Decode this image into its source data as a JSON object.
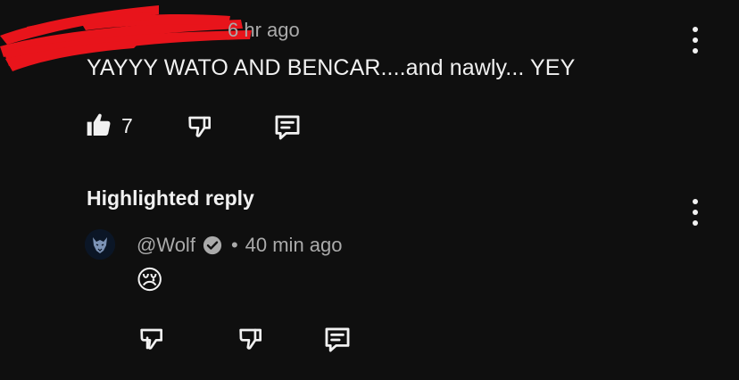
{
  "comment": {
    "timestamp": "6 hr ago",
    "text": "YAYYY WATO AND BENCAR....and nawly... YEY",
    "like_count": "7",
    "icons": [
      "like-icon",
      "dislike-icon",
      "reply-icon",
      "more-options-icon"
    ]
  },
  "highlighted_reply": {
    "label": "Highlighted reply",
    "author": "@Wolf",
    "separator": "•",
    "timestamp": "40 min ago",
    "text": "😢",
    "icons": [
      "avatar",
      "verified-icon",
      "like-icon",
      "dislike-icon",
      "reply-icon",
      "more-options-icon"
    ]
  },
  "colors": {
    "background": "#0f0f0f",
    "text": "#f1f1f1",
    "secondary_text": "#aaaaaa",
    "redaction": "#e8141b"
  }
}
